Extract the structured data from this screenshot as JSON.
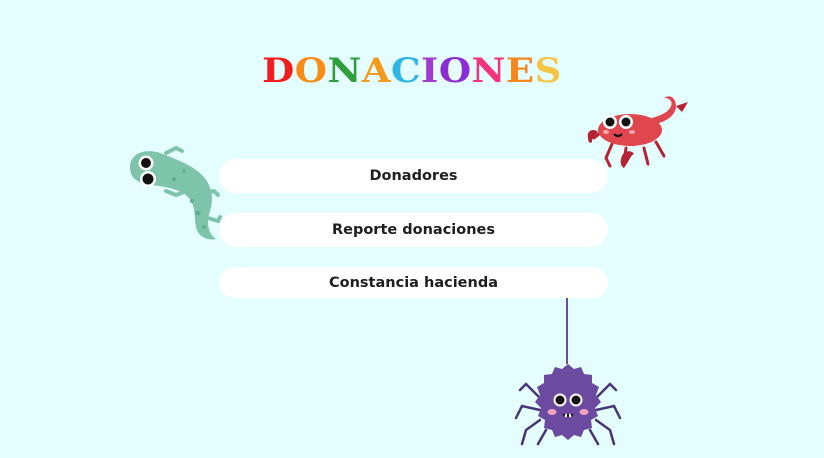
{
  "title": {
    "letters": [
      {
        "ch": "D",
        "color": "#f21d1d"
      },
      {
        "ch": "O",
        "color": "#fa8c16"
      },
      {
        "ch": "N",
        "color": "#2e9e3c"
      },
      {
        "ch": "A",
        "color": "#f59a1a"
      },
      {
        "ch": "C",
        "color": "#2fb4e6"
      },
      {
        "ch": "I",
        "color": "#a13ad1"
      },
      {
        "ch": "O",
        "color": "#8c2cd6"
      },
      {
        "ch": "N",
        "color": "#f2347b"
      },
      {
        "ch": "E",
        "color": "#f5881f"
      },
      {
        "ch": "S",
        "color": "#f6c548"
      }
    ]
  },
  "menu": {
    "donadores_label": "Donadores",
    "reporte_label": "Reporte donaciones",
    "constancia_label": "Constancia hacienda"
  },
  "colors": {
    "background": "#e4fdfe",
    "button_bg": "#ffffff",
    "lizard": "#7ec4aa",
    "scorpion": "#e0464e",
    "spider": "#6b4aa0"
  },
  "icons": {
    "lizard": "lizard-illustration",
    "scorpion": "scorpion-illustration",
    "spider": "spider-illustration"
  }
}
